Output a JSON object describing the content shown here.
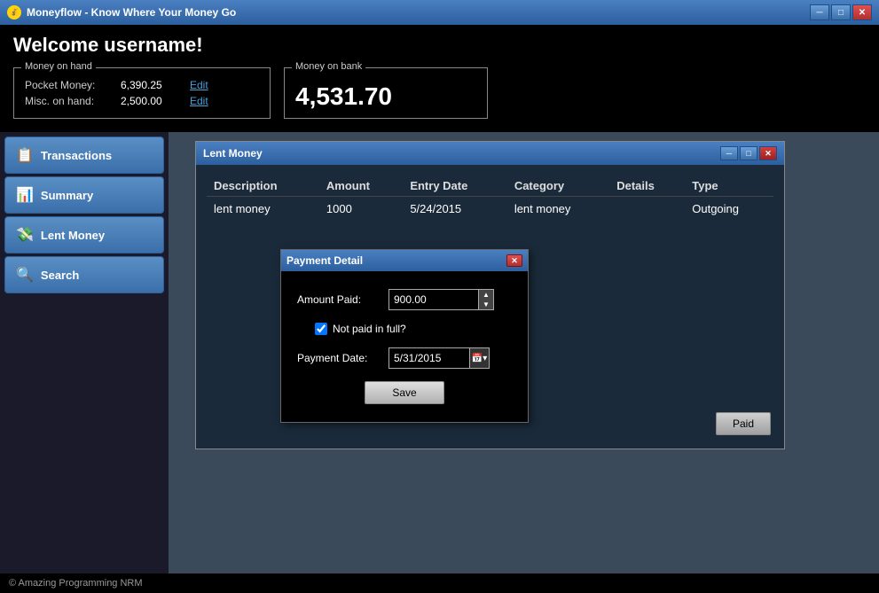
{
  "titleBar": {
    "title": "Moneyflow - Know Where Your Money Go",
    "minimizeLabel": "─",
    "maximizeLabel": "□",
    "closeLabel": "✕"
  },
  "header": {
    "welcomeText": "Welcome username!",
    "moneyOnHandLabel": "Money on hand",
    "pocketMoneyLabel": "Pocket Money:",
    "pocketMoneyValue": "6,390.25",
    "miscOnHandLabel": "Misc. on hand:",
    "miscOnHandValue": "2,500.00",
    "editLabel": "Edit",
    "moneyOnBankLabel": "Money on bank",
    "bankAmount": "4,531.70"
  },
  "sidebar": {
    "items": [
      {
        "id": "transactions",
        "label": "Transactions",
        "icon": "📋"
      },
      {
        "id": "summary",
        "label": "Summary",
        "icon": "📊"
      },
      {
        "id": "lent-money",
        "label": "Lent Money",
        "icon": "💸"
      },
      {
        "id": "search",
        "label": "Search",
        "icon": "🔍"
      }
    ]
  },
  "lentMoneyWindow": {
    "title": "Lent Money",
    "columns": [
      "Description",
      "Amount",
      "Entry Date",
      "Category",
      "Details",
      "Type"
    ],
    "rows": [
      {
        "description": "lent money",
        "amount": "1000",
        "entryDate": "5/24/2015",
        "category": "lent money",
        "details": "",
        "type": "Outgoing"
      }
    ],
    "paidBtnLabel": "Paid",
    "windowControls": {
      "minimize": "─",
      "maximize": "□",
      "close": "✕"
    }
  },
  "paymentDialog": {
    "title": "Payment Detail",
    "closeLabel": "✕",
    "amountPaidLabel": "Amount Paid:",
    "amountPaidValue": "900.00",
    "notPaidCheckboxLabel": "Not paid in full?",
    "notPaidChecked": true,
    "paymentDateLabel": "Payment Date:",
    "paymentDateValue": "5/31/2015",
    "saveLabel": "Save"
  },
  "footer": {
    "copyright": "© Amazing Programming NRM"
  }
}
